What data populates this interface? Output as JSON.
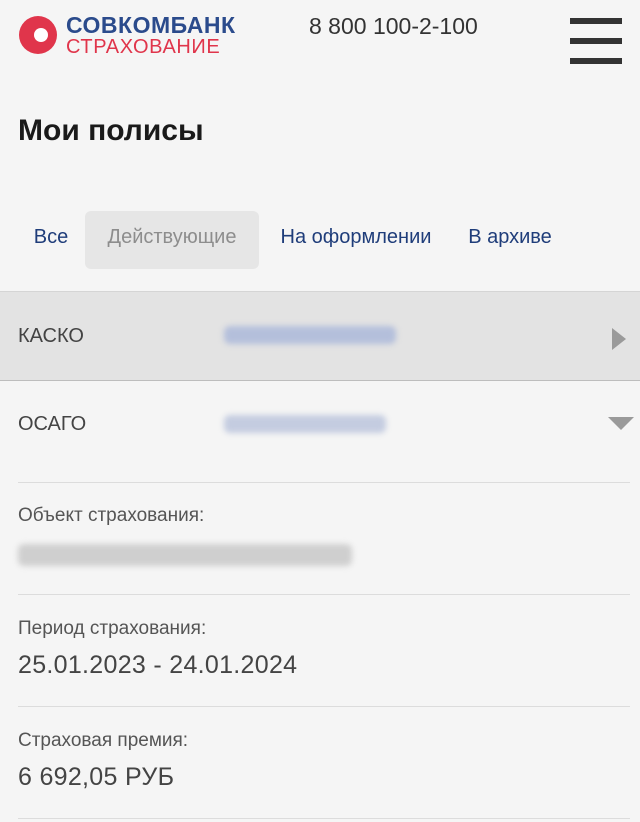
{
  "header": {
    "logo_line1": "СОВКОМБАНК",
    "logo_line2": "СТРАХОВАНИЕ",
    "phone": "8 800 100-2-100",
    "menu_icon": "hamburger-menu-icon"
  },
  "page_title": "Мои полисы",
  "tabs": [
    {
      "label": "Все"
    },
    {
      "label": "Действующие",
      "active": true
    },
    {
      "label": "На оформлении"
    },
    {
      "label": "В архиве"
    }
  ],
  "policies": [
    {
      "type": "КАСКО",
      "expanded": false,
      "icon": "chevron-right-icon"
    },
    {
      "type": "ОСАГО",
      "expanded": true,
      "icon": "chevron-down-icon"
    }
  ],
  "details": {
    "object_label": "Объект страхования:",
    "period_label": "Период страхования:",
    "period_value": "25.01.2023 - 24.01.2024",
    "premium_label": "Страховая премия:",
    "premium_value": "6 692,05 РУБ"
  },
  "colors": {
    "brand_blue": "#2b4b8c",
    "brand_red": "#e0354b",
    "tab_text": "#1f3d7a",
    "active_tab_bg": "#e6e6e6"
  }
}
